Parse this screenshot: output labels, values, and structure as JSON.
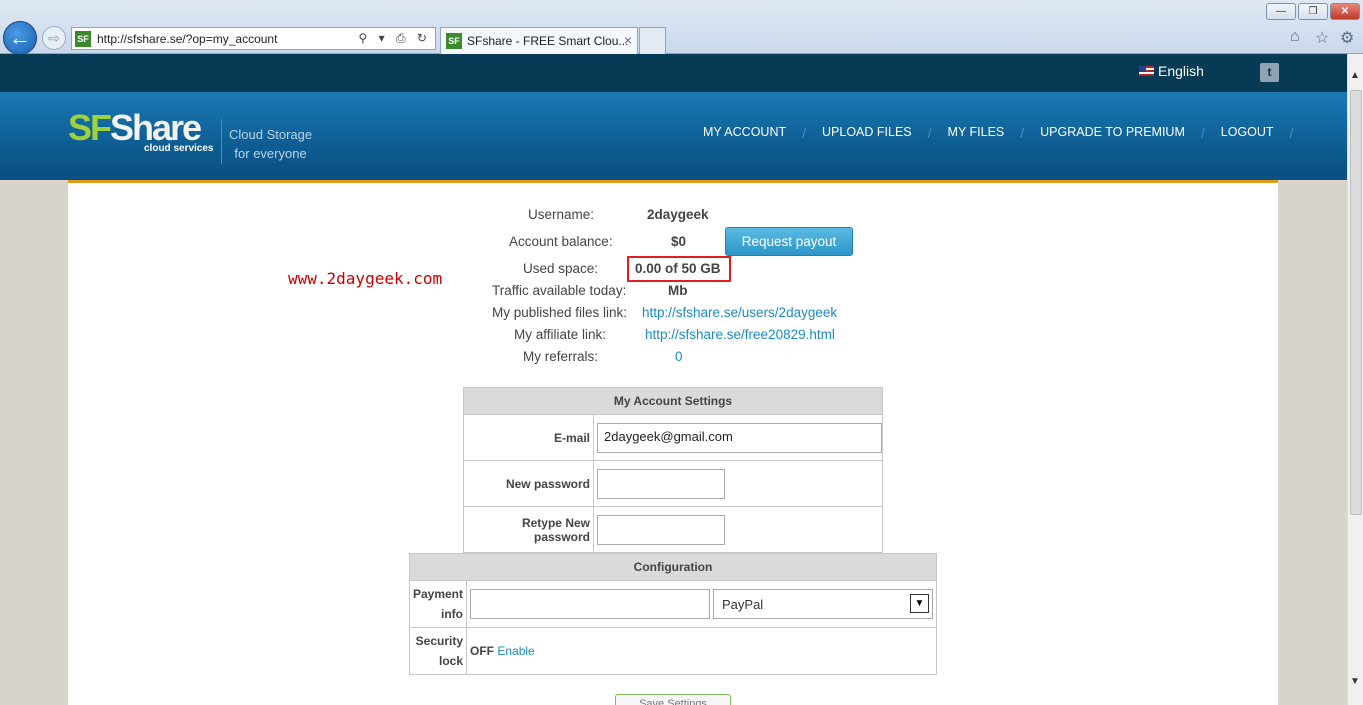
{
  "browser": {
    "url": "http://sfshare.se/?op=my_account",
    "tab_title": "SFshare - FREE Smart Clou...",
    "favicon_text": "SF",
    "tab_close": "×",
    "window_min": "—",
    "window_max": "❐",
    "window_close": "✕",
    "back_glyph": "←",
    "forward_glyph": "⇨",
    "addr_icons": "⚲ ▾ ⎙ ↻"
  },
  "topbar": {
    "language": "English",
    "twitter_glyph": "t"
  },
  "header": {
    "logo_sf": "SF",
    "logo_share": "Share",
    "logo_sub": "cloud services",
    "tagline_1": "Cloud Storage",
    "tagline_2": "for everyone",
    "nav": [
      "MY ACCOUNT",
      "UPLOAD FILES",
      "MY FILES",
      "UPGRADE TO PREMIUM",
      "LOGOUT"
    ],
    "nav_sep": "/"
  },
  "watermark": "www.2daygeek.com",
  "account": {
    "username_label": "Username:",
    "username_value": "2daygeek",
    "balance_label": "Account balance:",
    "balance_value": "$0",
    "payout_button": "Request payout",
    "used_label": "Used space:",
    "used_value": "0.00 of 50 GB",
    "traffic_label": "Traffic available today:",
    "traffic_value": "Mb",
    "published_label": "My published files link:",
    "published_value": "http://sfshare.se/users/2daygeek",
    "affiliate_label": "My affiliate link:",
    "affiliate_value": "http://sfshare.se/free20829.html",
    "referrals_label": "My referrals:",
    "referrals_value": "0"
  },
  "settings": {
    "title": "My Account Settings",
    "email_label": "E-mail",
    "email_value": "2daygeek@gmail.com",
    "new_password_label": "New password",
    "retype_password_label": "Retype New password"
  },
  "config": {
    "title": "Configuration",
    "payment_label_1": "Payment",
    "payment_label_2": "info",
    "payment_method": "PayPal",
    "security_label_1": "Security",
    "security_label_2": "lock",
    "security_status": "OFF",
    "security_action": "Enable"
  },
  "save_button": "Save Settings",
  "scrollbar": {
    "up": "▲",
    "down": "▼"
  }
}
